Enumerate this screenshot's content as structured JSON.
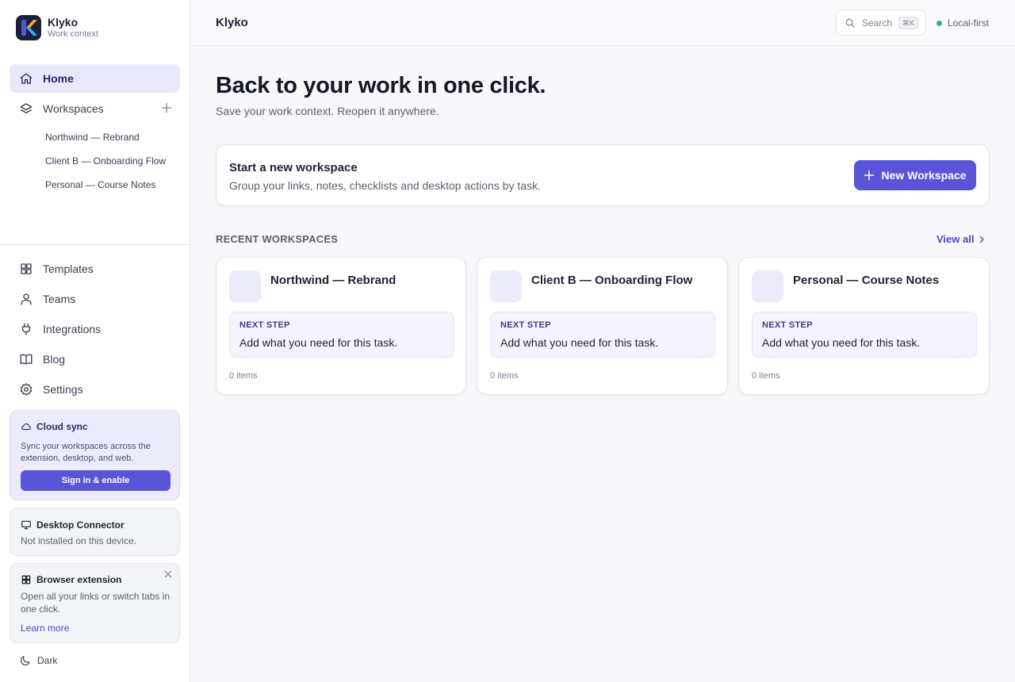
{
  "app": {
    "name": "Klyko",
    "subtitle": "Work context"
  },
  "sidebar": {
    "home": "Home",
    "workspaces": "Workspaces",
    "workspace_items": [
      "Northwind — Rebrand",
      "Client B — Onboarding Flow",
      "Personal — Course Notes"
    ],
    "bottom_items": [
      "Templates",
      "Teams",
      "Integrations",
      "Blog",
      "Settings"
    ],
    "cloud_sync": {
      "title": "Cloud sync",
      "text": "Sync your workspaces across the extension, desktop, and web.",
      "button": "Sign in & enable"
    },
    "desktop_connector": {
      "title": "Desktop Connector",
      "text": "Not installed on this device."
    },
    "browser_extension": {
      "title": "Browser extension",
      "text": "Open all your links or switch tabs in one click.",
      "link": "Learn more"
    },
    "theme_toggle": "Dark"
  },
  "topbar": {
    "title": "Klyko",
    "search_label": "Search",
    "search_shortcut": "⌘K",
    "status": "Local-first"
  },
  "main": {
    "title": "Back to your work in one click.",
    "subtitle": "Save your work context. Reopen it anywhere.",
    "start": {
      "title": "Start a new workspace",
      "text": "Group your links, notes, checklists and desktop actions by task.",
      "button": "New Workspace"
    },
    "recent_label": "RECENT WORKSPACES",
    "view_all": "View all",
    "recent": [
      {
        "name": "Northwind — Rebrand",
        "step_label": "NEXT STEP",
        "step_text": "Add what you need for this task.",
        "count": "0 items"
      },
      {
        "name": "Client B — Onboarding Flow",
        "step_label": "NEXT STEP",
        "step_text": "Add what you need for this task.",
        "count": "0 items"
      },
      {
        "name": "Personal — Course Notes",
        "step_label": "NEXT STEP",
        "step_text": "Add what you need for this task.",
        "count": "0 items"
      }
    ]
  },
  "colors": {
    "accent": "#5a55d8",
    "active_nav_bg": "#e9e8fb",
    "status_dot": "#22b59a"
  }
}
